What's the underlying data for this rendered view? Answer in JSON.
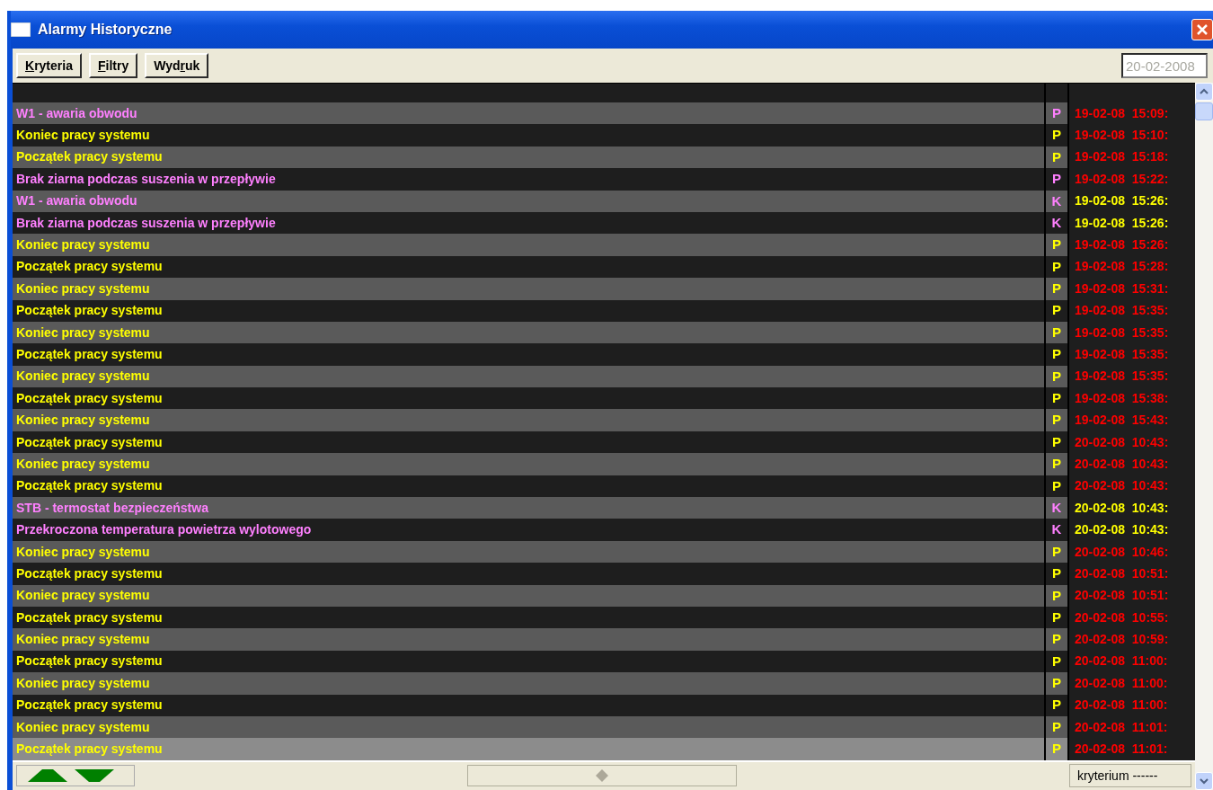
{
  "window": {
    "title": "Alarmy Historyczne"
  },
  "toolbar": {
    "buttons": [
      {
        "key": "K",
        "rest": "ryteria"
      },
      {
        "key": "F",
        "rest": "iltry"
      },
      {
        "pre": "Wyd",
        "key": "r",
        "rest": "uk"
      }
    ],
    "date_field": {
      "value": "20-02-2008",
      "disabled": true
    }
  },
  "table": {
    "rows": [
      {
        "message": "W1 - awaria obwodu",
        "kind": "alarm",
        "type": "P",
        "time": "19-02-08  15:09:",
        "active": true,
        "selected": false
      },
      {
        "message": "Koniec pracy systemu",
        "kind": "event",
        "type": "P",
        "time": "19-02-08  15:10:",
        "active": true,
        "selected": false
      },
      {
        "message": "Początek pracy systemu",
        "kind": "event",
        "type": "P",
        "time": "19-02-08  15:18:",
        "active": true,
        "selected": false
      },
      {
        "message": "Brak ziarna podczas suszenia w przepływie",
        "kind": "alarm",
        "type": "P",
        "time": "19-02-08  15:22:",
        "active": true,
        "selected": false
      },
      {
        "message": "W1 - awaria obwodu",
        "kind": "alarm",
        "type": "K",
        "time": "19-02-08  15:26:",
        "active": false,
        "selected": false
      },
      {
        "message": "Brak ziarna podczas suszenia w przepływie",
        "kind": "alarm",
        "type": "K",
        "time": "19-02-08  15:26:",
        "active": false,
        "selected": false
      },
      {
        "message": "Koniec pracy systemu",
        "kind": "event",
        "type": "P",
        "time": "19-02-08  15:26:",
        "active": true,
        "selected": false
      },
      {
        "message": "Początek pracy systemu",
        "kind": "event",
        "type": "P",
        "time": "19-02-08  15:28:",
        "active": true,
        "selected": false
      },
      {
        "message": "Koniec pracy systemu",
        "kind": "event",
        "type": "P",
        "time": "19-02-08  15:31:",
        "active": true,
        "selected": false
      },
      {
        "message": "Początek pracy systemu",
        "kind": "event",
        "type": "P",
        "time": "19-02-08  15:35:",
        "active": true,
        "selected": false
      },
      {
        "message": "Koniec pracy systemu",
        "kind": "event",
        "type": "P",
        "time": "19-02-08  15:35:",
        "active": true,
        "selected": false
      },
      {
        "message": "Początek pracy systemu",
        "kind": "event",
        "type": "P",
        "time": "19-02-08  15:35:",
        "active": true,
        "selected": false
      },
      {
        "message": "Koniec pracy systemu",
        "kind": "event",
        "type": "P",
        "time": "19-02-08  15:35:",
        "active": true,
        "selected": false
      },
      {
        "message": "Początek pracy systemu",
        "kind": "event",
        "type": "P",
        "time": "19-02-08  15:38:",
        "active": true,
        "selected": false
      },
      {
        "message": "Koniec pracy systemu",
        "kind": "event",
        "type": "P",
        "time": "19-02-08  15:43:",
        "active": true,
        "selected": false
      },
      {
        "message": "Początek pracy systemu",
        "kind": "event",
        "type": "P",
        "time": "20-02-08  10:43:",
        "active": true,
        "selected": false
      },
      {
        "message": "Koniec pracy systemu",
        "kind": "event",
        "type": "P",
        "time": "20-02-08  10:43:",
        "active": true,
        "selected": false
      },
      {
        "message": "Początek pracy systemu",
        "kind": "event",
        "type": "P",
        "time": "20-02-08  10:43:",
        "active": true,
        "selected": false
      },
      {
        "message": "STB - termostat bezpieczeństwa",
        "kind": "alarm",
        "type": "K",
        "time": "20-02-08  10:43:",
        "active": false,
        "selected": false
      },
      {
        "message": "Przekroczona temperatura powietrza wylotowego",
        "kind": "alarm",
        "type": "K",
        "time": "20-02-08  10:43:",
        "active": false,
        "selected": false
      },
      {
        "message": "Koniec pracy systemu",
        "kind": "event",
        "type": "P",
        "time": "20-02-08  10:46:",
        "active": true,
        "selected": false
      },
      {
        "message": "Początek pracy systemu",
        "kind": "event",
        "type": "P",
        "time": "20-02-08  10:51:",
        "active": true,
        "selected": false
      },
      {
        "message": "Koniec pracy systemu",
        "kind": "event",
        "type": "P",
        "time": "20-02-08  10:51:",
        "active": true,
        "selected": false
      },
      {
        "message": "Początek pracy systemu",
        "kind": "event",
        "type": "P",
        "time": "20-02-08  10:55:",
        "active": true,
        "selected": false
      },
      {
        "message": "Koniec pracy systemu",
        "kind": "event",
        "type": "P",
        "time": "20-02-08  10:59:",
        "active": true,
        "selected": false
      },
      {
        "message": "Początek pracy systemu",
        "kind": "event",
        "type": "P",
        "time": "20-02-08  11:00:",
        "active": true,
        "selected": false
      },
      {
        "message": "Koniec pracy systemu",
        "kind": "event",
        "type": "P",
        "time": "20-02-08  11:00:",
        "active": true,
        "selected": false
      },
      {
        "message": "Początek pracy systemu",
        "kind": "event",
        "type": "P",
        "time": "20-02-08  11:00:",
        "active": true,
        "selected": false
      },
      {
        "message": "Koniec pracy systemu",
        "kind": "event",
        "type": "P",
        "time": "20-02-08  11:01:",
        "active": true,
        "selected": false
      },
      {
        "message": "Początek pracy systemu",
        "kind": "event",
        "type": "P",
        "time": "20-02-08  11:01:",
        "active": true,
        "selected": true
      }
    ]
  },
  "bottom_bar": {
    "criterion_field": {
      "value": "kryterium ------"
    }
  }
}
